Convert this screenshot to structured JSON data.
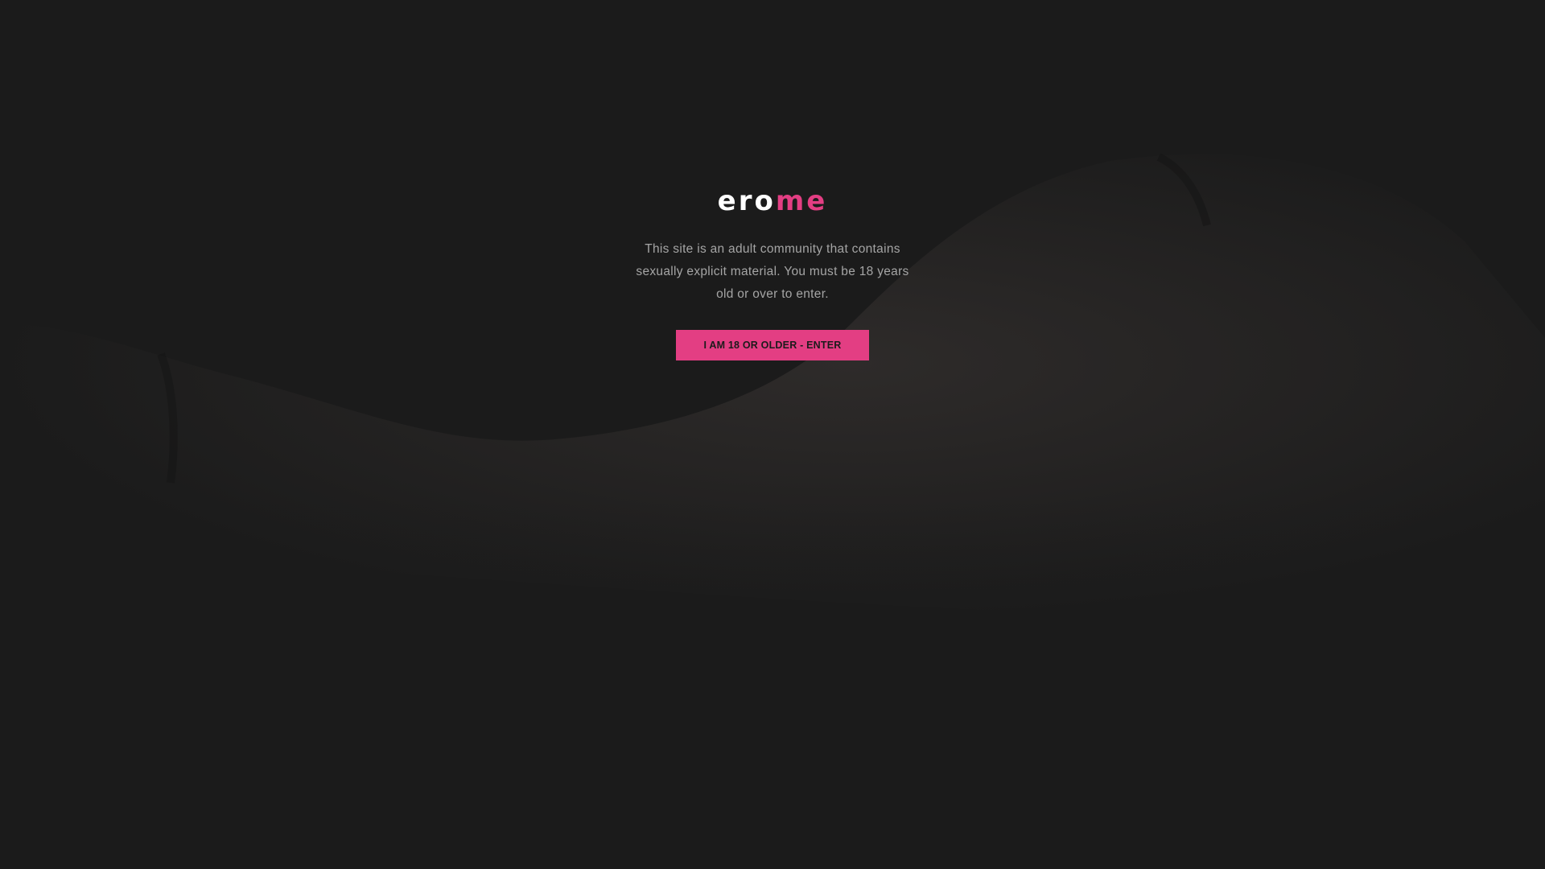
{
  "logo": {
    "part1": "ero",
    "part2": "me"
  },
  "message": "This site is an adult community that contains sexually explicit material. You must be 18 years old or over to enter.",
  "enter_button": {
    "label": "I AM 18 OR OLDER - ENTER"
  },
  "colors": {
    "background": "#1b1b1b",
    "accent": "#e33e83",
    "text": "#a5a5a5",
    "logo": "#ffffff"
  }
}
